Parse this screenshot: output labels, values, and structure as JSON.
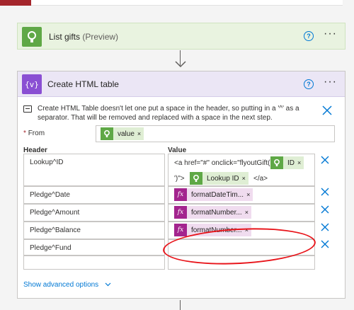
{
  "list_gifts": {
    "title": "List gifts",
    "suffix": "(Preview)",
    "icon": "lock-keyhole-icon",
    "color": "#5fa846"
  },
  "html_table": {
    "title": "Create HTML table",
    "icon": "curly-braces-icon",
    "color": "#8a4fd3",
    "info_text": "Create HTML Table doesn't let one put a space in the header, so putting in a '^' as a separator. That will be removed and replaced with a space in the next step.",
    "from_label": "From",
    "from_token": "value",
    "header_label": "Header",
    "value_label": "Value",
    "rows": [
      {
        "header": "Lookup^ID"
      },
      {
        "header": "Pledge^Date",
        "token": "formatDateTim..."
      },
      {
        "header": "Pledge^Amount",
        "token": "formatNumber..."
      },
      {
        "header": "Pledge^Balance",
        "token": "formatNumber..."
      },
      {
        "header": "Pledge^Fund"
      },
      {
        "header": ""
      }
    ],
    "lookup_value": {
      "prefix": "<a href=\"#\" onclick=\"flyoutGift('",
      "token1": "ID",
      "mid": "')\">",
      "token2": "Lookup ID",
      "suffix": "</a>"
    },
    "fx_label": "fx",
    "advanced": "Show advanced options"
  },
  "icons": {
    "help": "?",
    "more": "···",
    "close": "×",
    "token_remove": "×",
    "chevron": "⌵"
  },
  "colors": {
    "accent_link": "#0078d4",
    "annotation": "#e8141a"
  }
}
